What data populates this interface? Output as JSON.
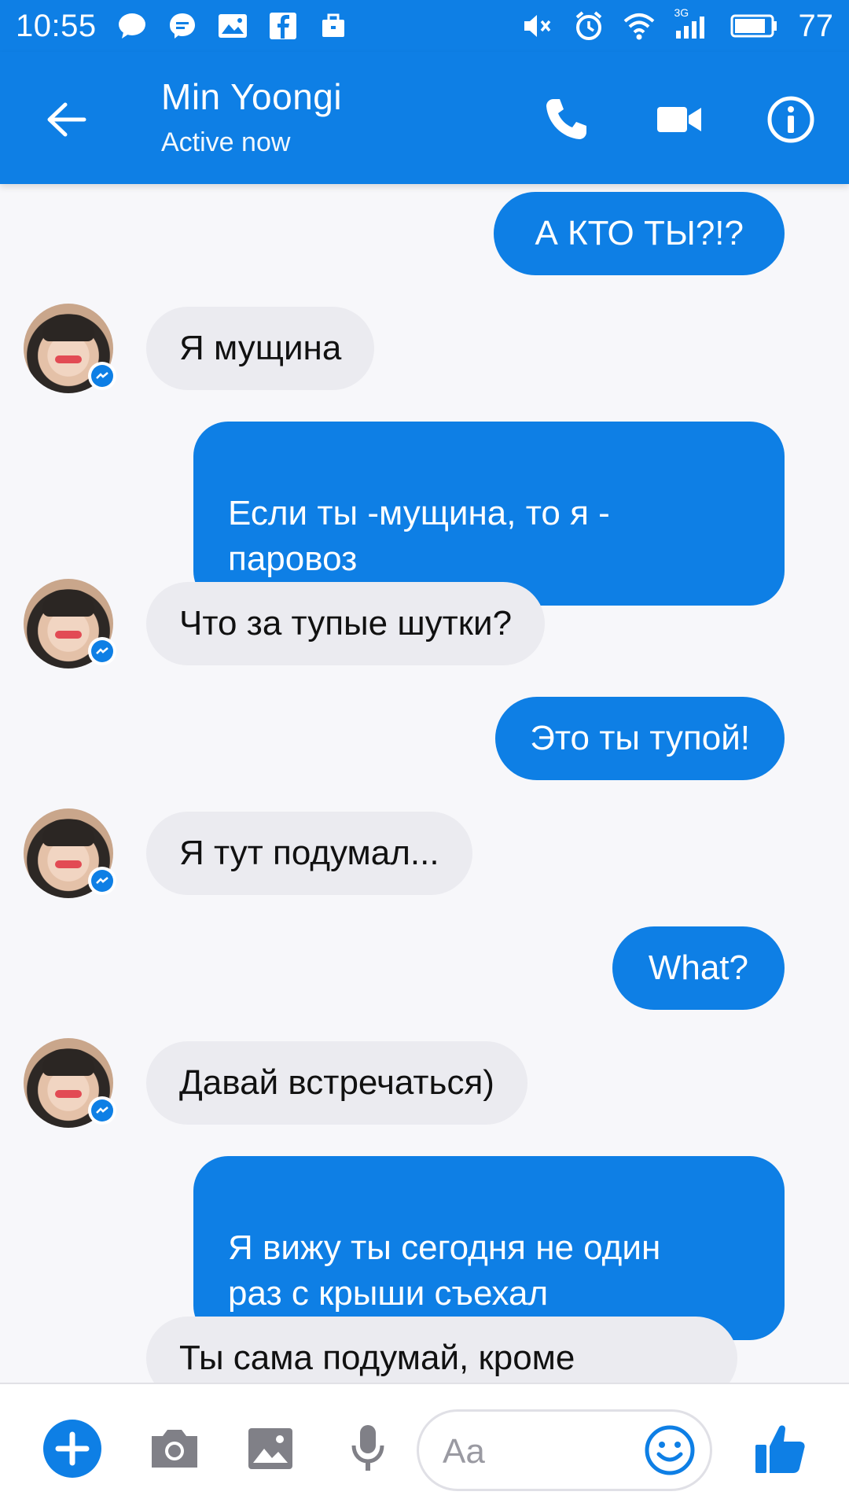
{
  "status_bar": {
    "time": "10:55",
    "battery": "77",
    "network": "3G"
  },
  "header": {
    "title": "Min Yoongi",
    "subtitle": "Active now",
    "icons": [
      "back-arrow-icon",
      "phone-icon",
      "video-camera-icon",
      "info-icon"
    ]
  },
  "messages": [
    {
      "side": "out",
      "text": "А КТО ТЫ?!?"
    },
    {
      "side": "in",
      "text": "Я мущина"
    },
    {
      "side": "out",
      "text": "Если ты -мущина, то я -\nпаровоз"
    },
    {
      "side": "in",
      "text": "Что за тупые шутки?"
    },
    {
      "side": "out",
      "text": "Это ты тупой!"
    },
    {
      "side": "in",
      "text": "Я тут подумал..."
    },
    {
      "side": "out",
      "text": "What?"
    },
    {
      "side": "in",
      "text": "Давай встречаться)"
    },
    {
      "side": "out",
      "text": "Я вижу ты сегодня не один\nраз с крыши съехал"
    },
    {
      "side": "in",
      "text": "Ты сама подумай, кроме"
    }
  ],
  "composer": {
    "placeholder": "Aa",
    "icons": [
      "plus-icon",
      "camera-icon",
      "gallery-icon",
      "microphone-icon",
      "emoji-icon",
      "thumbs-up-icon"
    ]
  },
  "colors": {
    "accent": "#0e7fe5",
    "incoming_bubble": "#ebebf0",
    "background": "#f7f7fa"
  }
}
